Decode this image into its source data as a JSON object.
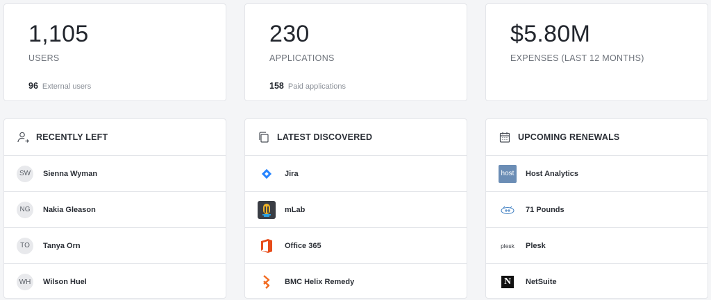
{
  "stats": [
    {
      "value": "1,105",
      "label": "USERS",
      "sub_value": "96",
      "sub_label": "External users"
    },
    {
      "value": "230",
      "label": "APPLICATIONS",
      "sub_value": "158",
      "sub_label": "Paid applications"
    },
    {
      "value": "$5.80M",
      "label": "EXPENSES (LAST 12 MONTHS)"
    }
  ],
  "recently_left": {
    "title": "RECENTLY LEFT",
    "icon": "user-leave-icon",
    "items": [
      {
        "initials": "SW",
        "name": "Sienna Wyman"
      },
      {
        "initials": "NG",
        "name": "Nakia Gleason"
      },
      {
        "initials": "TO",
        "name": "Tanya Orn"
      },
      {
        "initials": "WH",
        "name": "Wilson Huel"
      }
    ]
  },
  "latest_discovered": {
    "title": "LATEST DISCOVERED",
    "icon": "copy-icon",
    "items": [
      {
        "name": "Jira",
        "logo": "jira-logo"
      },
      {
        "name": "mLab",
        "logo": "mlab-logo"
      },
      {
        "name": "Office 365",
        "logo": "office-logo"
      },
      {
        "name": "BMC Helix Remedy",
        "logo": "bmc-logo"
      }
    ]
  },
  "upcoming_renewals": {
    "title": "UPCOMING RENEWALS",
    "icon": "calendar-icon",
    "items": [
      {
        "name": "Host Analytics",
        "logo": "host-logo",
        "logo_text": "host"
      },
      {
        "name": "71 Pounds",
        "logo": "71pounds-logo"
      },
      {
        "name": "Plesk",
        "logo": "plesk-logo",
        "logo_text": "plesk"
      },
      {
        "name": "NetSuite",
        "logo": "netsuite-logo",
        "logo_text": "N"
      }
    ]
  }
}
